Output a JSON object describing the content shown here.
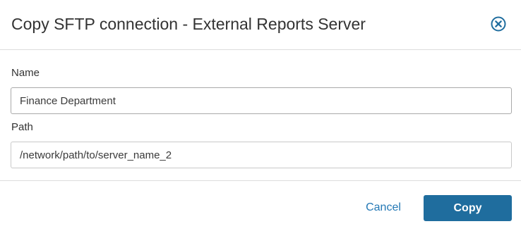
{
  "dialog": {
    "title": "Copy SFTP connection - External Reports Server",
    "close_icon": "close-circle-icon"
  },
  "form": {
    "name_label": "Name",
    "name_value": "Finance Department",
    "path_label": "Path",
    "path_value": "/network/path/to/server_name_2"
  },
  "footer": {
    "cancel_label": "Cancel",
    "copy_label": "Copy"
  },
  "colors": {
    "accent": "#1f6d9e",
    "link": "#2378b5",
    "divider": "#dcdcdc"
  }
}
